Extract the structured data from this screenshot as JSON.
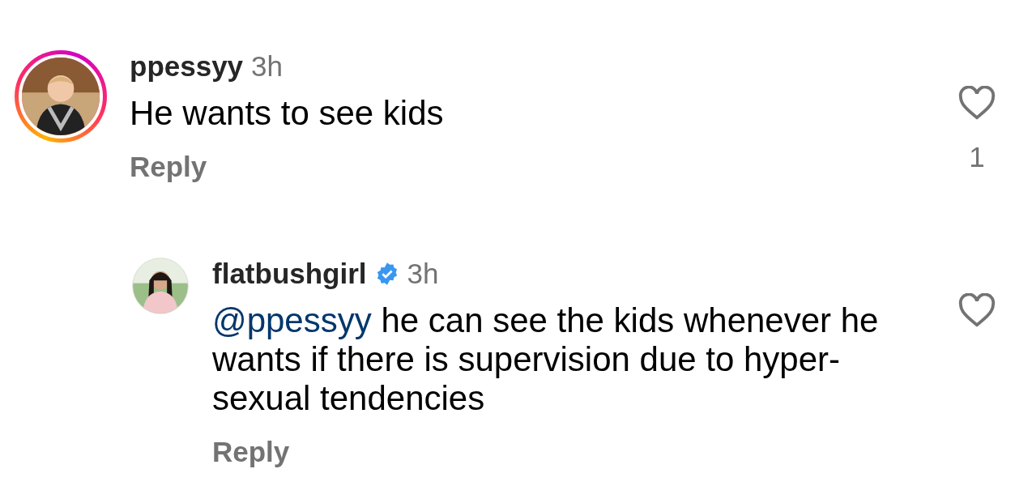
{
  "comments": [
    {
      "username": "ppessyy",
      "verified": false,
      "has_story": true,
      "time": "3h",
      "text": "He wants to see kids",
      "reply": "Reply",
      "liked": false,
      "likes": "1",
      "indented": false
    },
    {
      "username": "flatbushgirl",
      "verified": true,
      "has_story": false,
      "time": "3h",
      "mention": "@ppessyy",
      "text": " he can see the kids whenever he wants if there is supervision due to hyper-sexual tendencies",
      "reply": "Reply",
      "liked": false,
      "indented": true
    }
  ]
}
